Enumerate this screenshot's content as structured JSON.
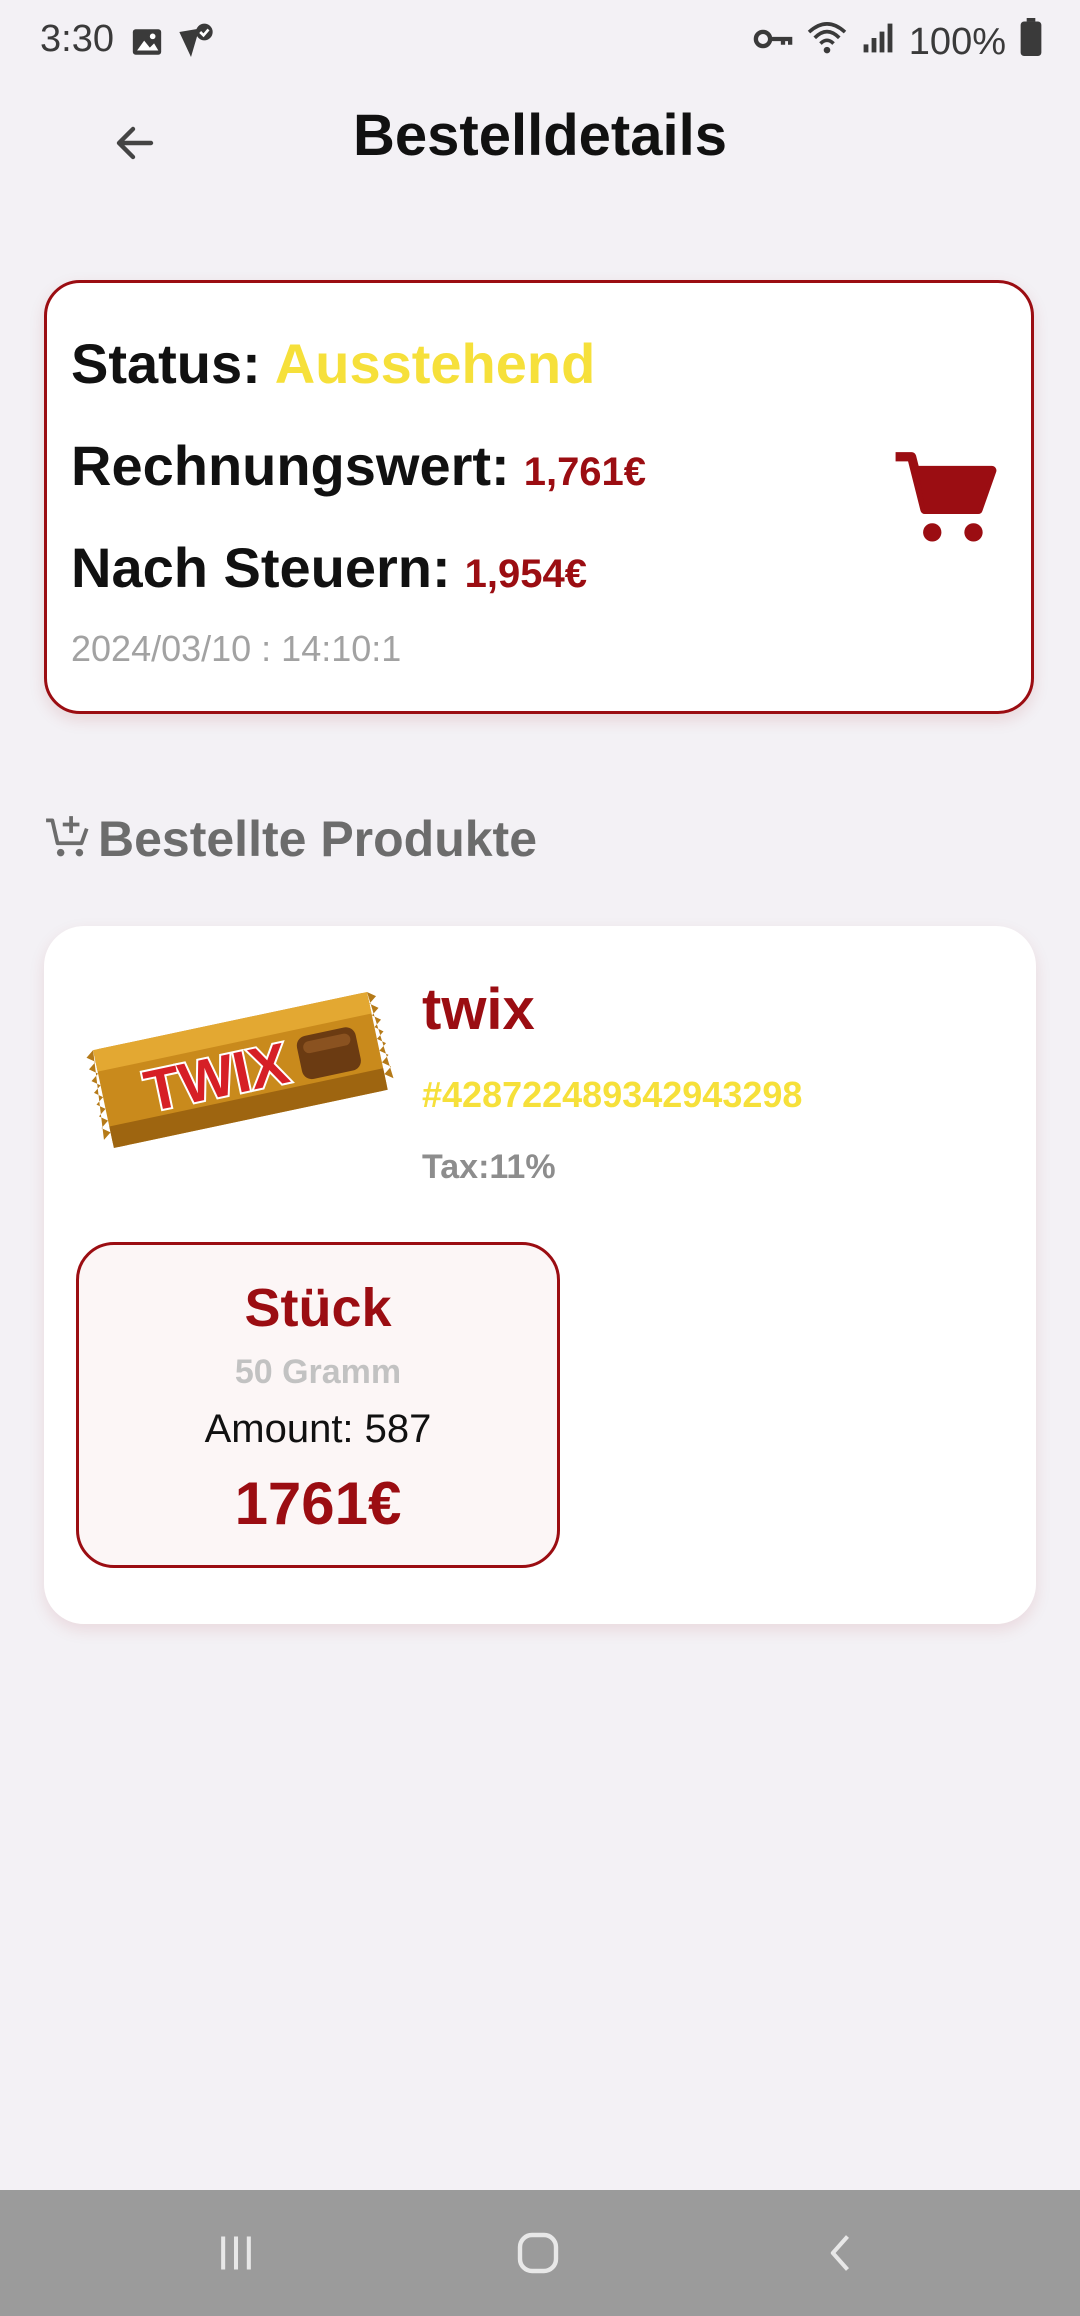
{
  "status_bar": {
    "time": "3:30",
    "battery": "100%",
    "icons": [
      "gallery-icon",
      "location-check-icon",
      "vpn-key-icon",
      "wifi-icon",
      "signal-icon",
      "battery-icon"
    ]
  },
  "app_bar": {
    "title": "Bestelldetails",
    "back_icon": "arrow-back-icon"
  },
  "order": {
    "status_label": "Status:",
    "status_value": "Ausstehend",
    "invoice_label": "Rechnungswert:",
    "invoice_value": "1,761€",
    "after_tax_label": "Nach Steuern:",
    "after_tax_value": "1,954€",
    "datetime": "2024/03/10 : 14:10:1",
    "cart_icon": "shopping-cart-icon"
  },
  "section": {
    "title": "Bestellte Produkte",
    "icon": "add-cart-icon"
  },
  "products": [
    {
      "name": "twix",
      "id": "#428722489342943298",
      "tax": "Tax:11%",
      "image_text": "TWIX",
      "unit": {
        "name": "Stück",
        "weight": "50 Gramm",
        "amount": "Amount: 587",
        "price": "1761€"
      }
    }
  ],
  "colors": {
    "accent": "#9b0d12",
    "status": "#f6e03a",
    "background": "#f3f1f5"
  }
}
